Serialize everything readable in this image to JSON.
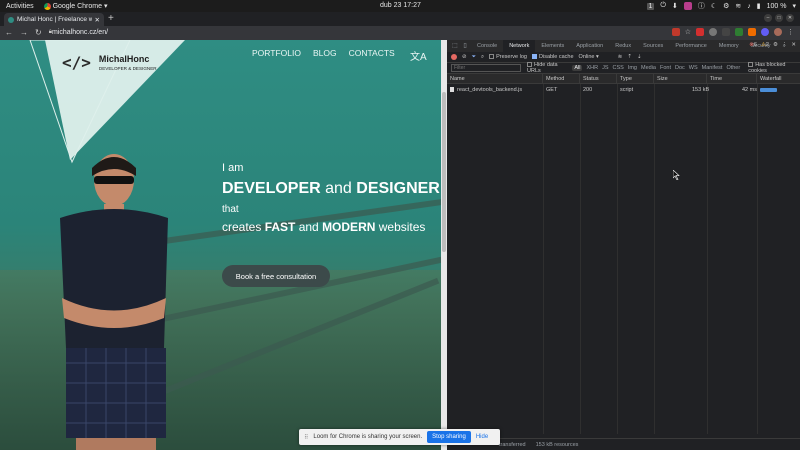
{
  "os_bar": {
    "activities": "Activities",
    "app_name": "Google Chrome",
    "clock": "dub 23  17:27",
    "workspace": "1",
    "battery": "100 %"
  },
  "browser": {
    "tab_title": "Michal Honc | Freelance w",
    "url": "michalhonc.cz/en/"
  },
  "website": {
    "logo_mark": "</>",
    "logo_name": "MichalHonc",
    "logo_tagline": "DEVELOPER & DESIGNER",
    "nav": [
      "PORTFOLIO",
      "BLOG",
      "CONTACTS"
    ],
    "hero": {
      "line1": "I am",
      "line2_a": "DEVELOPER",
      "line2_b": " and ",
      "line2_c": "DESIGNER",
      "line3": "that",
      "line4_a": "creates ",
      "line4_b": "FAST",
      "line4_c": " and ",
      "line4_d": "MODERN",
      "line4_e": " websites"
    },
    "cta": "Book a free consultation",
    "colors": {
      "accent": "#2f8d83",
      "button": "#3c4a4a"
    }
  },
  "devtools": {
    "tabs": [
      "Console",
      "Network",
      "Elements",
      "Application",
      "Redux",
      "Sources",
      "Performance",
      "Memory",
      "Security"
    ],
    "active_tab": "Network",
    "badges": {
      "errors": "6",
      "warnings": "2"
    },
    "toolbar": {
      "preserve_log": "Preserve log",
      "disable_cache": "Disable cache",
      "throttle": "Online"
    },
    "filter": {
      "placeholder": "Filter",
      "hide_data_urls": "Hide data URLs",
      "types": [
        "All",
        "XHR",
        "JS",
        "CSS",
        "Img",
        "Media",
        "Font",
        "Doc",
        "WS",
        "Manifest",
        "Other"
      ],
      "blocked": "Has blocked cookies"
    },
    "columns": [
      "Name",
      "Method",
      "Status",
      "Type",
      "Size",
      "Time",
      "Waterfall"
    ],
    "rows": [
      {
        "name": "react_devtools_backend.js",
        "method": "GET",
        "status": "200",
        "type": "script",
        "size": "153 kB",
        "time": "42 ms"
      }
    ],
    "status_bar": {
      "transferred": "transferred",
      "resources": "153 kB resources"
    }
  },
  "loom": {
    "message": "Loom for Chrome is sharing your screen.",
    "stop": "Stop sharing",
    "hide": "Hide"
  }
}
